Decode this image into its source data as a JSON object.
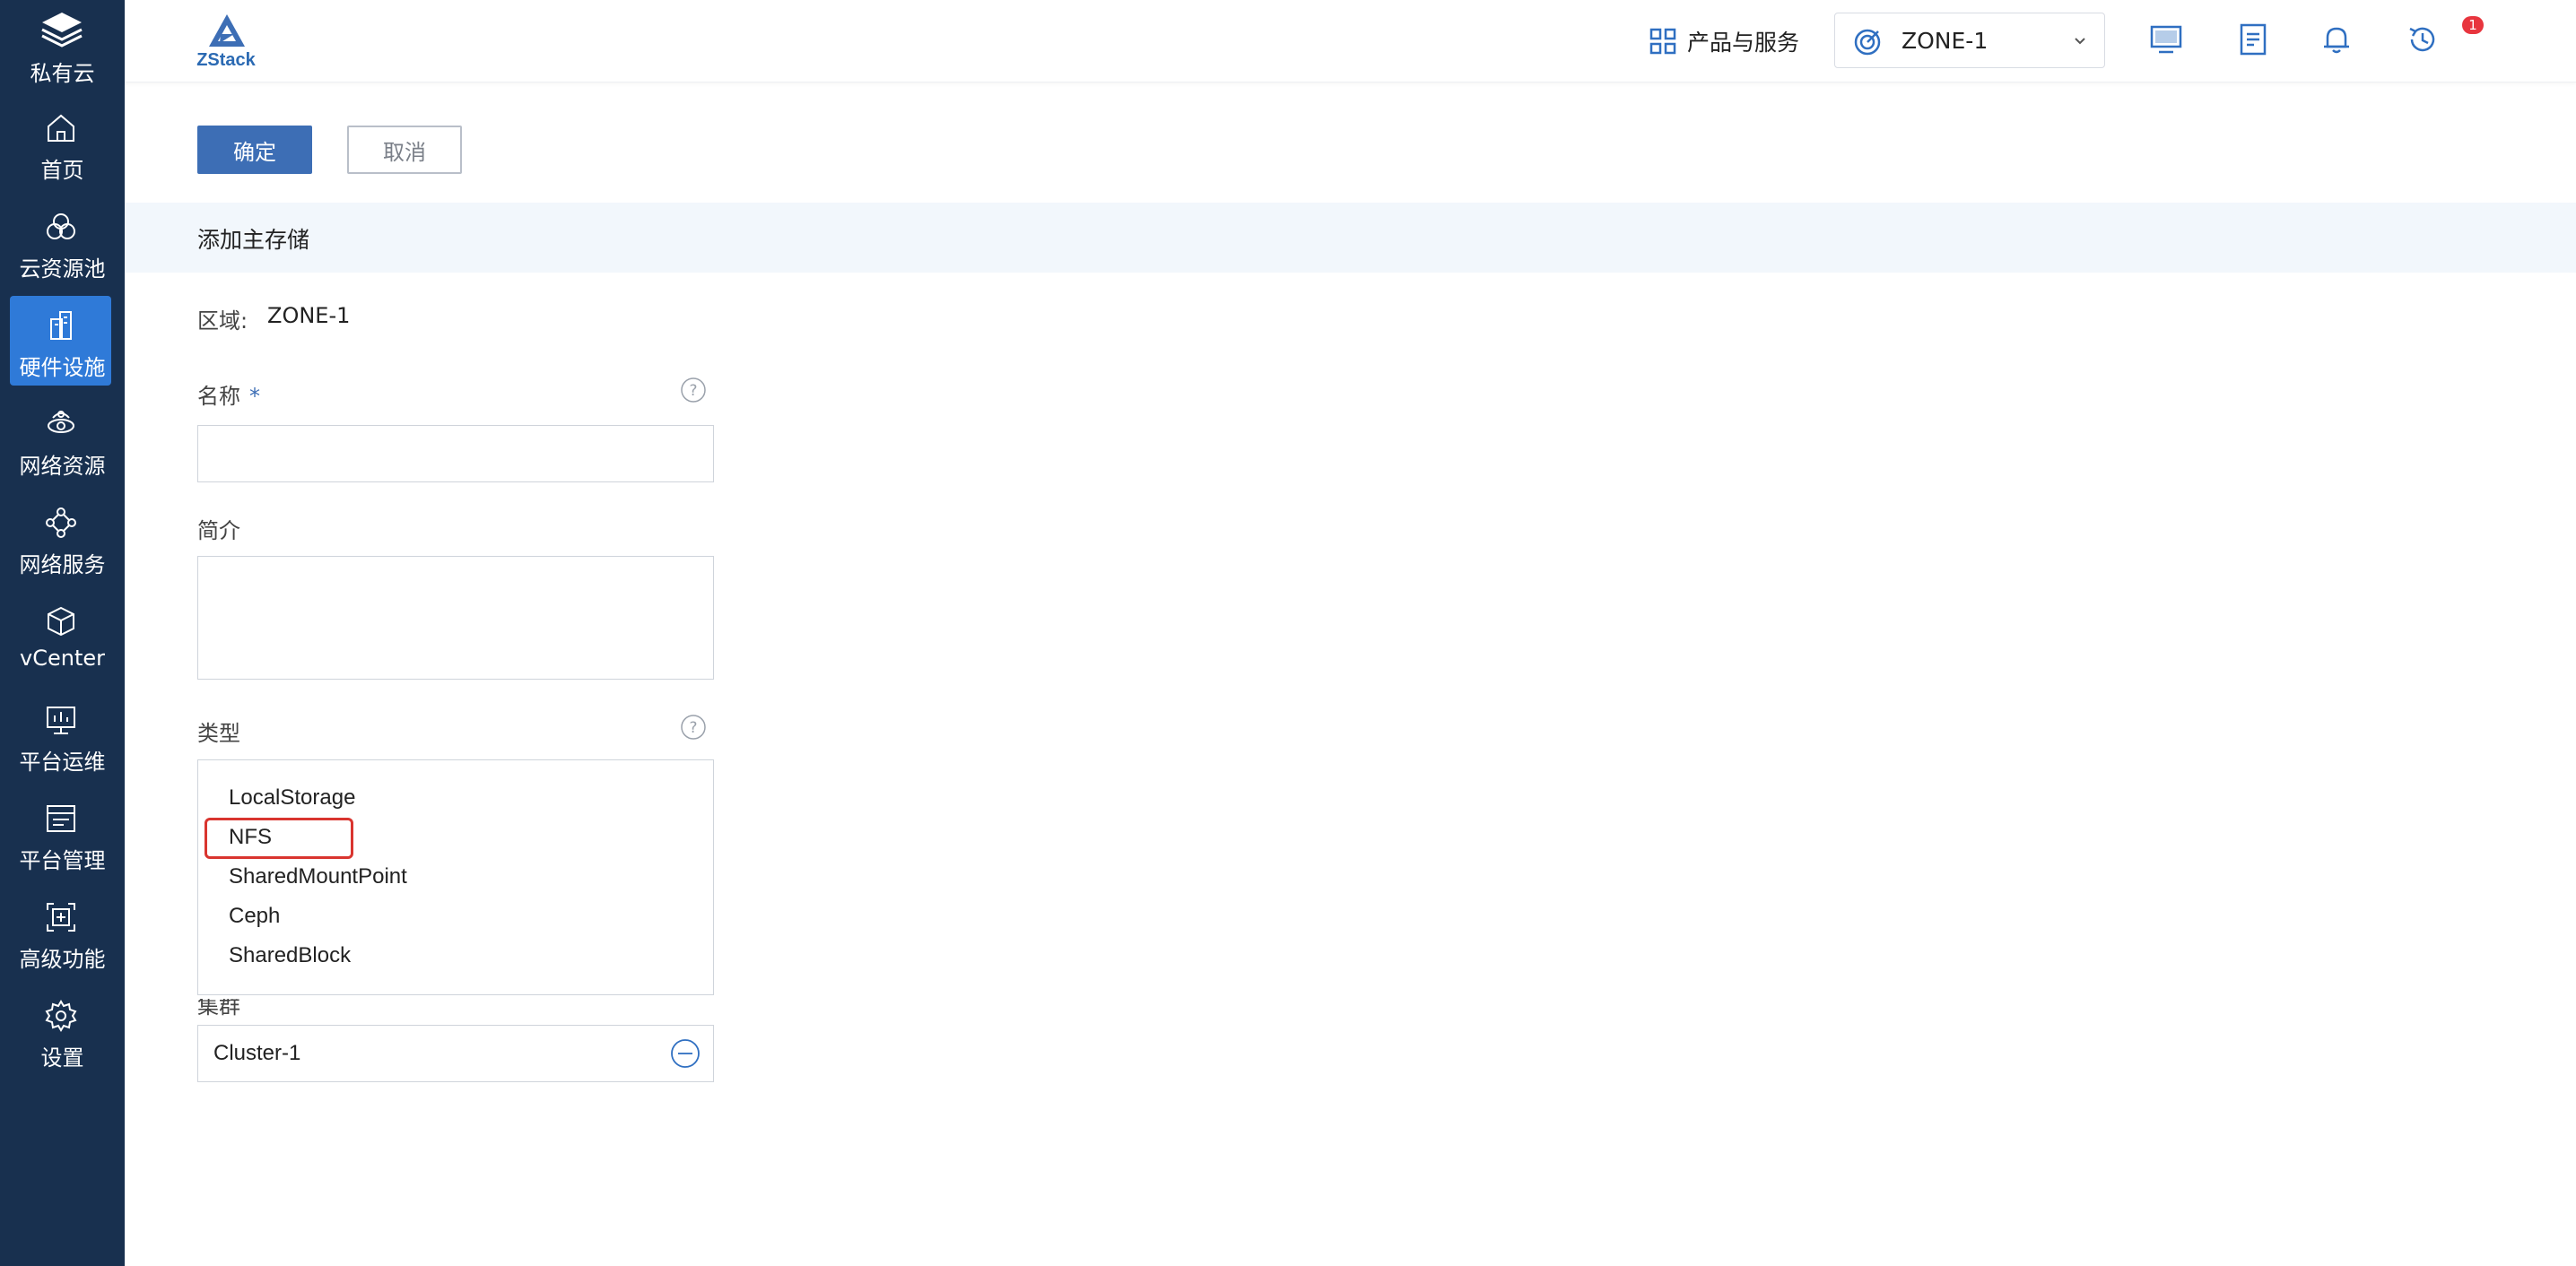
{
  "sidebar": {
    "brand_label": "私有云",
    "items": [
      {
        "label": "首页",
        "icon": "home-icon"
      },
      {
        "label": "云资源池",
        "icon": "cloud-resource-icon"
      },
      {
        "label": "硬件设施",
        "icon": "hardware-icon",
        "active": true
      },
      {
        "label": "网络资源",
        "icon": "network-resource-icon"
      },
      {
        "label": "网络服务",
        "icon": "network-service-icon"
      },
      {
        "label": "vCenter",
        "icon": "vcenter-icon"
      },
      {
        "label": "平台运维",
        "icon": "ops-icon"
      },
      {
        "label": "平台管理",
        "icon": "platform-manage-icon"
      },
      {
        "label": "高级功能",
        "icon": "advanced-icon"
      },
      {
        "label": "设置",
        "icon": "settings-icon"
      }
    ]
  },
  "topbar": {
    "logo_text": "ZStack",
    "products_label": "产品与服务",
    "zone_selected": "ZONE-1",
    "notification_count": "1"
  },
  "actions": {
    "confirm_label": "确定",
    "cancel_label": "取消"
  },
  "form": {
    "section_title": "添加主存储",
    "zone_label": "区域:",
    "zone_value": "ZONE-1",
    "name_label": "名称",
    "name_value": "",
    "description_label": "简介",
    "description_value": "",
    "type_label": "类型",
    "type_options": [
      "LocalStorage",
      "NFS",
      "SharedMountPoint",
      "Ceph",
      "SharedBlock"
    ],
    "type_highlighted": "NFS",
    "cluster_label": "集群",
    "cluster_value": "Cluster-1"
  },
  "colors": {
    "sidebar_bg": "#18304f",
    "sidebar_active": "#2f7ad8",
    "primary_button": "#3d6eb5",
    "highlight_border": "#d9352f",
    "badge": "#e8353e"
  }
}
